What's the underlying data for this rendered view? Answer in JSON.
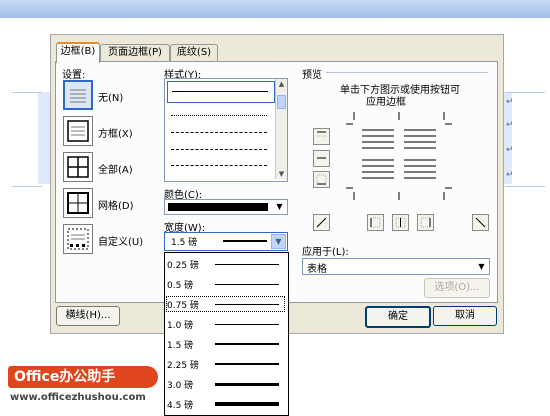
{
  "tabs": [
    {
      "label": "边框(B)",
      "active": true
    },
    {
      "label": "页面边框(P)",
      "active": false
    },
    {
      "label": "底纹(S)",
      "active": false
    }
  ],
  "settings": {
    "title": "设置:",
    "items": [
      {
        "label": "无(N)",
        "selected": true
      },
      {
        "label": "方框(X)",
        "selected": false
      },
      {
        "label": "全部(A)",
        "selected": false
      },
      {
        "label": "网格(D)",
        "selected": false
      },
      {
        "label": "自定义(U)",
        "selected": false
      }
    ]
  },
  "style": {
    "title": "样式(Y):"
  },
  "color": {
    "label": "颜色(C):",
    "value": "#000000"
  },
  "width": {
    "label": "宽度(W):",
    "value": "1.5 磅"
  },
  "width_options": [
    "0.25 磅",
    "0.5 磅",
    "0.75 磅",
    "1.0 磅",
    "1.5 磅",
    "2.25 磅",
    "3.0 磅",
    "4.5 磅"
  ],
  "width_highlighted": "0.75 磅",
  "preview": {
    "title": "预览",
    "instruction_line1": "单击下方图示或使用按钮可",
    "instruction_line2": "应用边框"
  },
  "apply_to": {
    "label": "应用于(L):",
    "value": "表格"
  },
  "buttons": {
    "options": "选项(O)...",
    "horizontal_line": "横线(H)...",
    "ok": "确定",
    "cancel": "取消"
  },
  "watermark": {
    "brand": "Office办公助手",
    "url": "www.officezhushou.com"
  },
  "colors": {
    "accent_tab": "#e68b2c",
    "selection": "#316ac5",
    "dialog_bg": "#ece9d8"
  }
}
